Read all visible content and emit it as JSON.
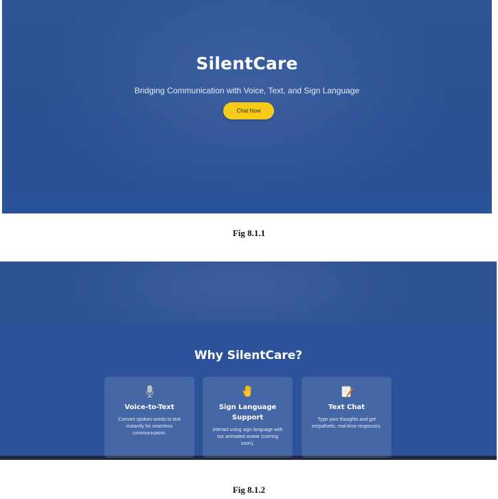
{
  "hero": {
    "title": "SilentCare",
    "subtitle": "Bridging Communication with Voice, Text, and Sign Language",
    "cta_label": "Chat Now"
  },
  "captions": {
    "fig1": "Fig 8.1.1",
    "fig2": "Fig 8.1.2"
  },
  "features": {
    "title": "Why SilentCare?",
    "cards": [
      {
        "icon": "microphone-icon",
        "title": "Voice-to-Text",
        "text": "Convert spoken words to text instantly for seamless communication."
      },
      {
        "icon": "raised-hand-icon",
        "title": "Sign Language Support",
        "text": "Interact using sign language with our animated avatar (coming soon)."
      },
      {
        "icon": "memo-pencil-icon",
        "title": "Text Chat",
        "text": "Type your thoughts and get empathetic, real-time responses."
      }
    ]
  },
  "colors": {
    "background": "#2c5194",
    "button": "#f6cc19",
    "text": "#ffffff"
  }
}
